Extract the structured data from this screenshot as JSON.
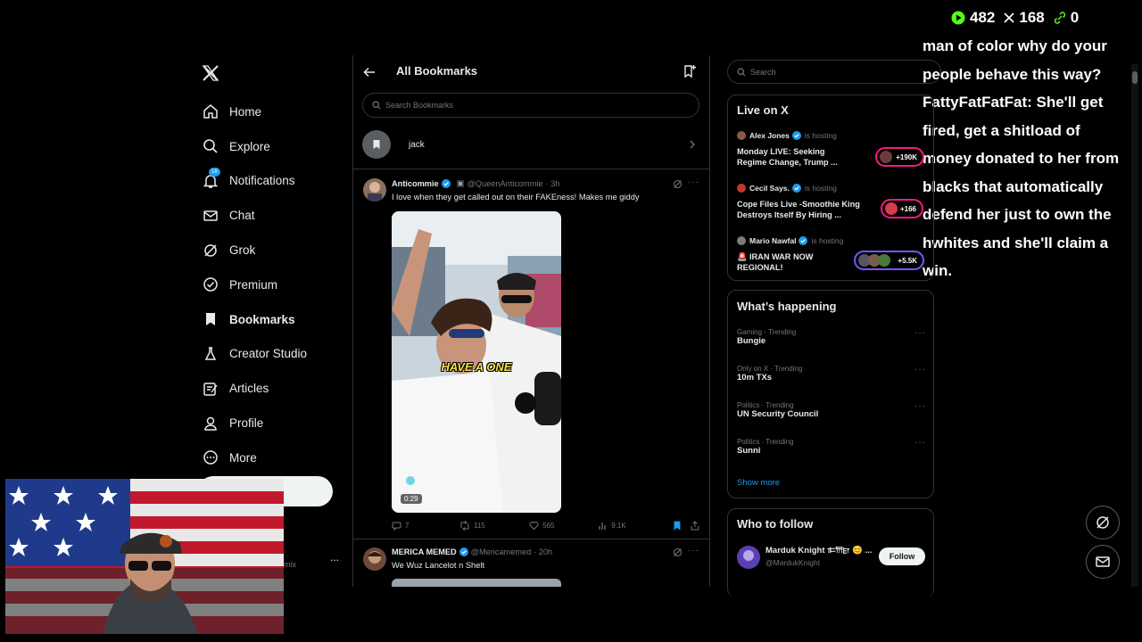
{
  "stream_stats": {
    "viewers": "482",
    "x_count": "168",
    "links": "0"
  },
  "chat_overlay": "man of color why do your people behave this way? FattyFatFatFat: She'll get fired, get a shitload of money donated to her from blacks that automatically defend her just to own the hwhites and she'll claim a win.",
  "nav": {
    "notifications_badge": "18",
    "items": [
      {
        "label": "Home",
        "icon": "home-icon"
      },
      {
        "label": "Explore",
        "icon": "search-icon"
      },
      {
        "label": "Notifications",
        "icon": "bell-icon"
      },
      {
        "label": "Chat",
        "icon": "mail-icon"
      },
      {
        "label": "Grok",
        "icon": "grok-icon"
      },
      {
        "label": "Premium",
        "icon": "premium-icon"
      },
      {
        "label": "Bookmarks",
        "icon": "bookmark-icon"
      },
      {
        "label": "Creator Studio",
        "icon": "flask-icon"
      },
      {
        "label": "Articles",
        "icon": "article-icon"
      },
      {
        "label": "Profile",
        "icon": "person-icon"
      },
      {
        "label": "More",
        "icon": "more-circle-icon"
      }
    ],
    "account_handle_fragment": "mix",
    "account_more": "..."
  },
  "bookmarks": {
    "title": "All Bookmarks",
    "search_placeholder": "Search Bookmarks",
    "folder": "jack"
  },
  "tweets": [
    {
      "name": "Anticommie",
      "handle": "@QueenAnticommie",
      "time": "· 3h",
      "text": "I love when they get called out on their FAKEness! Makes me giddy",
      "media_caption": "HAVE A ONE",
      "duration": "0:29",
      "replies": "7",
      "reposts": "115",
      "likes": "565",
      "views": "9.1K"
    },
    {
      "name": "MERICA MEMED",
      "handle": "@Mericamemed",
      "time": "· 20h",
      "text": "We Wuz Lancelot n Shelt"
    }
  ],
  "search": {
    "placeholder": "Search"
  },
  "live": {
    "title": "Live on X",
    "hosting_label": "is hosting",
    "spaces": [
      {
        "host": "Alex Jones",
        "title_line1": "Monday LIVE: Seeking",
        "title_line2": "Regime Change, Trump ...",
        "listeners": "+190K"
      },
      {
        "host": "Cecil Says.",
        "title_line1": "Cope Files Live -Smoothie King",
        "title_line2": "Destroys Itself By Hiring ...",
        "listeners": "+166"
      },
      {
        "host": "Mario Nawfal",
        "title_line1": "🚨 IRAN WAR NOW",
        "title_line2": "REGIONAL!",
        "listeners": "+5.5K"
      }
    ]
  },
  "happening": {
    "title": "What’s happening",
    "trends": [
      {
        "meta": "Gaming · Trending",
        "name": "Bungie"
      },
      {
        "meta": "Only on X · Trending",
        "name": "10m TXs"
      },
      {
        "meta": "Politics · Trending",
        "name": "UN Security Council"
      },
      {
        "meta": "Politics · Trending",
        "name": "Sunni"
      }
    ],
    "show_more": "Show more"
  },
  "who_to_follow": {
    "title": "Who to follow",
    "user_name": "Marduk Knight 𐎣𐎠𐎼 😊 ...",
    "user_handle": "@MardukKnight",
    "follow_label": "Follow"
  },
  "colors": {
    "accent": "#1d9bf0",
    "live_pink": "#f91880",
    "border": "#2f3336"
  }
}
